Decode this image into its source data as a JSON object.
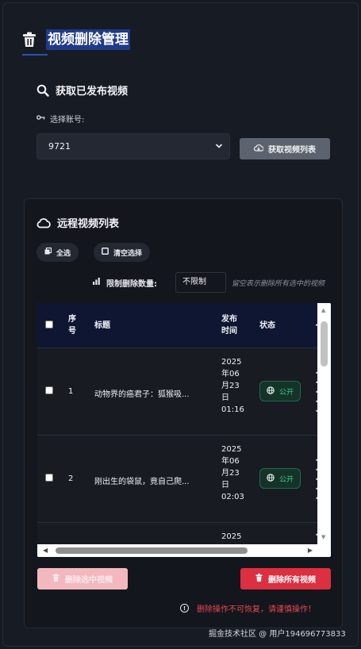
{
  "page": {
    "title": "视频删除管理"
  },
  "fetch": {
    "heading": "获取已发布视频",
    "account_label": "选择账号:",
    "account_value": "9721",
    "fetch_button": "获取视频列表"
  },
  "list": {
    "heading": "远程视频列表",
    "select_all": "全选",
    "clear_selection": "清空选择",
    "limit_label": "限制删除数量:",
    "limit_value": "不限制",
    "limit_hint": "留空表示删除所有选中的视频",
    "columns": [
      "序\n号",
      "标题",
      "发布\n时间",
      "状态"
    ],
    "col_index_1": "序",
    "col_index_2": "号",
    "col_title": "标题",
    "col_time_1": "发布",
    "col_time_2": "时间",
    "col_status": "状态",
    "rows": [
      {
        "index": "1",
        "title": "动物界的癌君子：狐猴吸...",
        "date_lines": [
          "2025",
          "年06",
          "月23",
          "日",
          "01:16"
        ],
        "status": "公开"
      },
      {
        "index": "2",
        "title": "刚出生的袋鼠，竟自己爬...",
        "date_lines": [
          "2025",
          "年06",
          "月23",
          "日",
          "02:03"
        ],
        "status": "公开"
      },
      {
        "index": "",
        "title": "",
        "date_lines": [
          "2025"
        ],
        "status": ""
      }
    ],
    "delete_selected": "删除选中视频",
    "delete_all": "删除所有视频",
    "warning": "删除操作不可恢复，请谨慎操作！"
  },
  "watermark": "掘金技术社区 @ 用户194696773833",
  "colors": {
    "accent": "#1f3a8a",
    "danger": "#dc2f40",
    "danger_disabled": "#f3b8be",
    "status_public": "#3ccf88",
    "table_header": "#0f1632"
  }
}
